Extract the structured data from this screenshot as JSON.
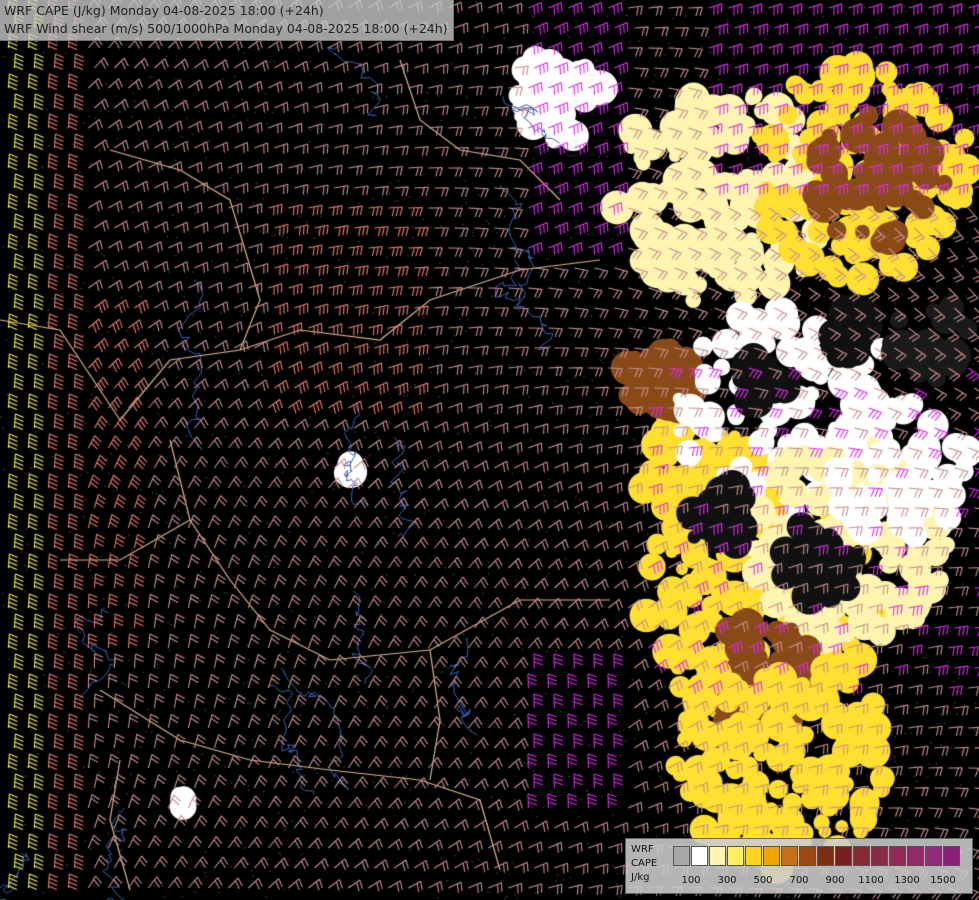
{
  "title": {
    "line1": "WRF CAPE (J/kg) Monday 04-08-2025 18:00 (+24h)",
    "line2": "WRF Wind shear (m/s) 500/1000hPa Monday 04-08-2025 18:00 (+24h)"
  },
  "legend": {
    "label_line1": "WRF",
    "label_line2": "CAPE",
    "label_line3": "J/kg",
    "colors": [
      "#a8a8a8",
      "#ffffff",
      "#fff5b0",
      "#ffef60",
      "#ffd21e",
      "#f2a400",
      "#c87015",
      "#9a4a14",
      "#7c2e12",
      "#7a1f1f",
      "#852a32",
      "#8a2a45",
      "#902a58",
      "#93296b",
      "#932a7c",
      "#8a1f75"
    ],
    "ticks": [
      "100",
      "300",
      "500",
      "700",
      "900",
      "1100",
      "1300",
      "1500"
    ]
  },
  "palette": {
    "background": "#000000",
    "border_line": "#d9b48c",
    "river_line": "#3a5fb0",
    "barb_light": "#c89090",
    "barb_salmon": "#e87b73",
    "barb_magenta": "#e02cf0",
    "barb_yellow": "#f0f040",
    "cape_white": "#ffffff",
    "cape_pale_yellow": "#fff5b0",
    "cape_yellow": "#ffdf30",
    "cape_brown": "#8a4a18"
  }
}
